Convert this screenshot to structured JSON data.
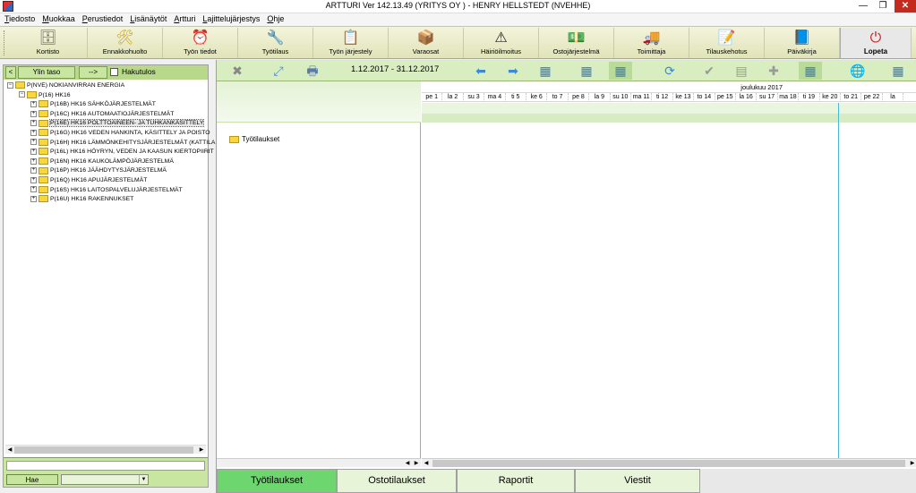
{
  "window": {
    "title": "ARTTURI Ver 142.13.49 (YRITYS OY ) - HENRY HELLSTEDT (NVEHHE)",
    "minimize": "—",
    "maximize": "❐",
    "close": "✕"
  },
  "menu": [
    "Tiedosto",
    "Muokkaa",
    "Perustiedot",
    "Lisänäytöt",
    "Artturi",
    "Lajittelujärjestys",
    "Ohje"
  ],
  "toolbar": [
    {
      "label": "Kortisto",
      "icon": "file-cabinet-icon",
      "glyph": "🗄"
    },
    {
      "label": "Ennakkohuolto",
      "icon": "tools-icon",
      "glyph": "🛠"
    },
    {
      "label": "Työn tiedot",
      "icon": "clock-icon",
      "glyph": "⏰"
    },
    {
      "label": "Työtilaus",
      "icon": "wrench-icon",
      "glyph": "🔧"
    },
    {
      "label": "Työn järjestely",
      "icon": "schedule-board-icon",
      "glyph": "📋"
    },
    {
      "label": "Varaosat",
      "icon": "parts-box-icon",
      "glyph": "📦"
    },
    {
      "label": "Häiriöilmoitus",
      "icon": "warning-icon",
      "glyph": "⚠"
    },
    {
      "label": "Ostojärjestelmä",
      "icon": "money-icon",
      "glyph": "💵"
    },
    {
      "label": "Toimittaja",
      "icon": "truck-icon",
      "glyph": "🚚"
    },
    {
      "label": "Tilauskehotus",
      "icon": "clipboard-icon",
      "glyph": "📝"
    },
    {
      "label": "Päiväkirja",
      "icon": "checkmark-book-icon",
      "glyph": "📘"
    },
    {
      "label": "Lopeta",
      "icon": "power-icon",
      "glyph": "⏻"
    }
  ],
  "left": {
    "back_arrow": "<",
    "top_level": "Ylin taso",
    "forward": "-->",
    "search_results": "Hakutulos",
    "tree": [
      {
        "label": "P(NVE) NOKIANVIRRAN ENERGIA",
        "level": 0,
        "exp": "−"
      },
      {
        "label": "P(16) HK16",
        "level": 1,
        "exp": "−"
      },
      {
        "label": "P(16B) HK16 SÄHKÖJÄRJESTELMÄT",
        "level": 2,
        "exp": "+"
      },
      {
        "label": "P(16C) HK16 AUTOMAATIOJÄRJESTELMÄT",
        "level": 2,
        "exp": "+"
      },
      {
        "label": "P(16E) HK16 POLTTOAINEEN- JA TUHKANKÄSITTELY",
        "level": 2,
        "exp": "+",
        "selected": true
      },
      {
        "label": "P(16G) HK16 VEDEN HANKINTA, KÄSITTELY JA POISTO",
        "level": 2,
        "exp": "+"
      },
      {
        "label": "P(16H) HK16 LÄMMÖNKEHITYSJÄRJESTELMÄT (KATTILAL",
        "level": 2,
        "exp": "+"
      },
      {
        "label": "P(16L) HK16 HÖYRYN, VEDEN JA KAASUN KIERTOPIIRIT",
        "level": 2,
        "exp": "+"
      },
      {
        "label": "P(16N) HK16 KAUKOLÄMPÖJÄRJESTELMÄ",
        "level": 2,
        "exp": "+"
      },
      {
        "label": "P(16P) HK16 JÄÄHDYTYSJÄRJESTELMÄ",
        "level": 2,
        "exp": "+"
      },
      {
        "label": "P(16Q) HK16 APUJÄRJESTELMÄT",
        "level": 2,
        "exp": "+"
      },
      {
        "label": "P(16S) HK16 LAITOSPALVELUJÄRJESTELMÄT",
        "level": 2,
        "exp": "+"
      },
      {
        "label": "P(16U) HK16 RAKENNUKSET",
        "level": 2,
        "exp": "+"
      }
    ],
    "search_button": "Hae"
  },
  "right": {
    "date_range": "1.12.2017 - 31.12.2017",
    "month": "joulukuu 2017",
    "days": [
      "pe 1",
      "la 2",
      "su 3",
      "ma 4",
      "ti 5",
      "ke 6",
      "to 7",
      "pe 8",
      "la 9",
      "su 10",
      "ma 11",
      "ti 12",
      "ke 13",
      "to 14",
      "pe 15",
      "la 16",
      "su 17",
      "ma 18",
      "ti 19",
      "ke 20",
      "to 21",
      "pe 22",
      "la"
    ],
    "row_label": "Työtilaukset",
    "today_fraction": 0.84,
    "tabs": [
      "Työtilaukset",
      "Ostotilaukset",
      "Raportit",
      "Viestit"
    ],
    "active_tab": 0
  }
}
